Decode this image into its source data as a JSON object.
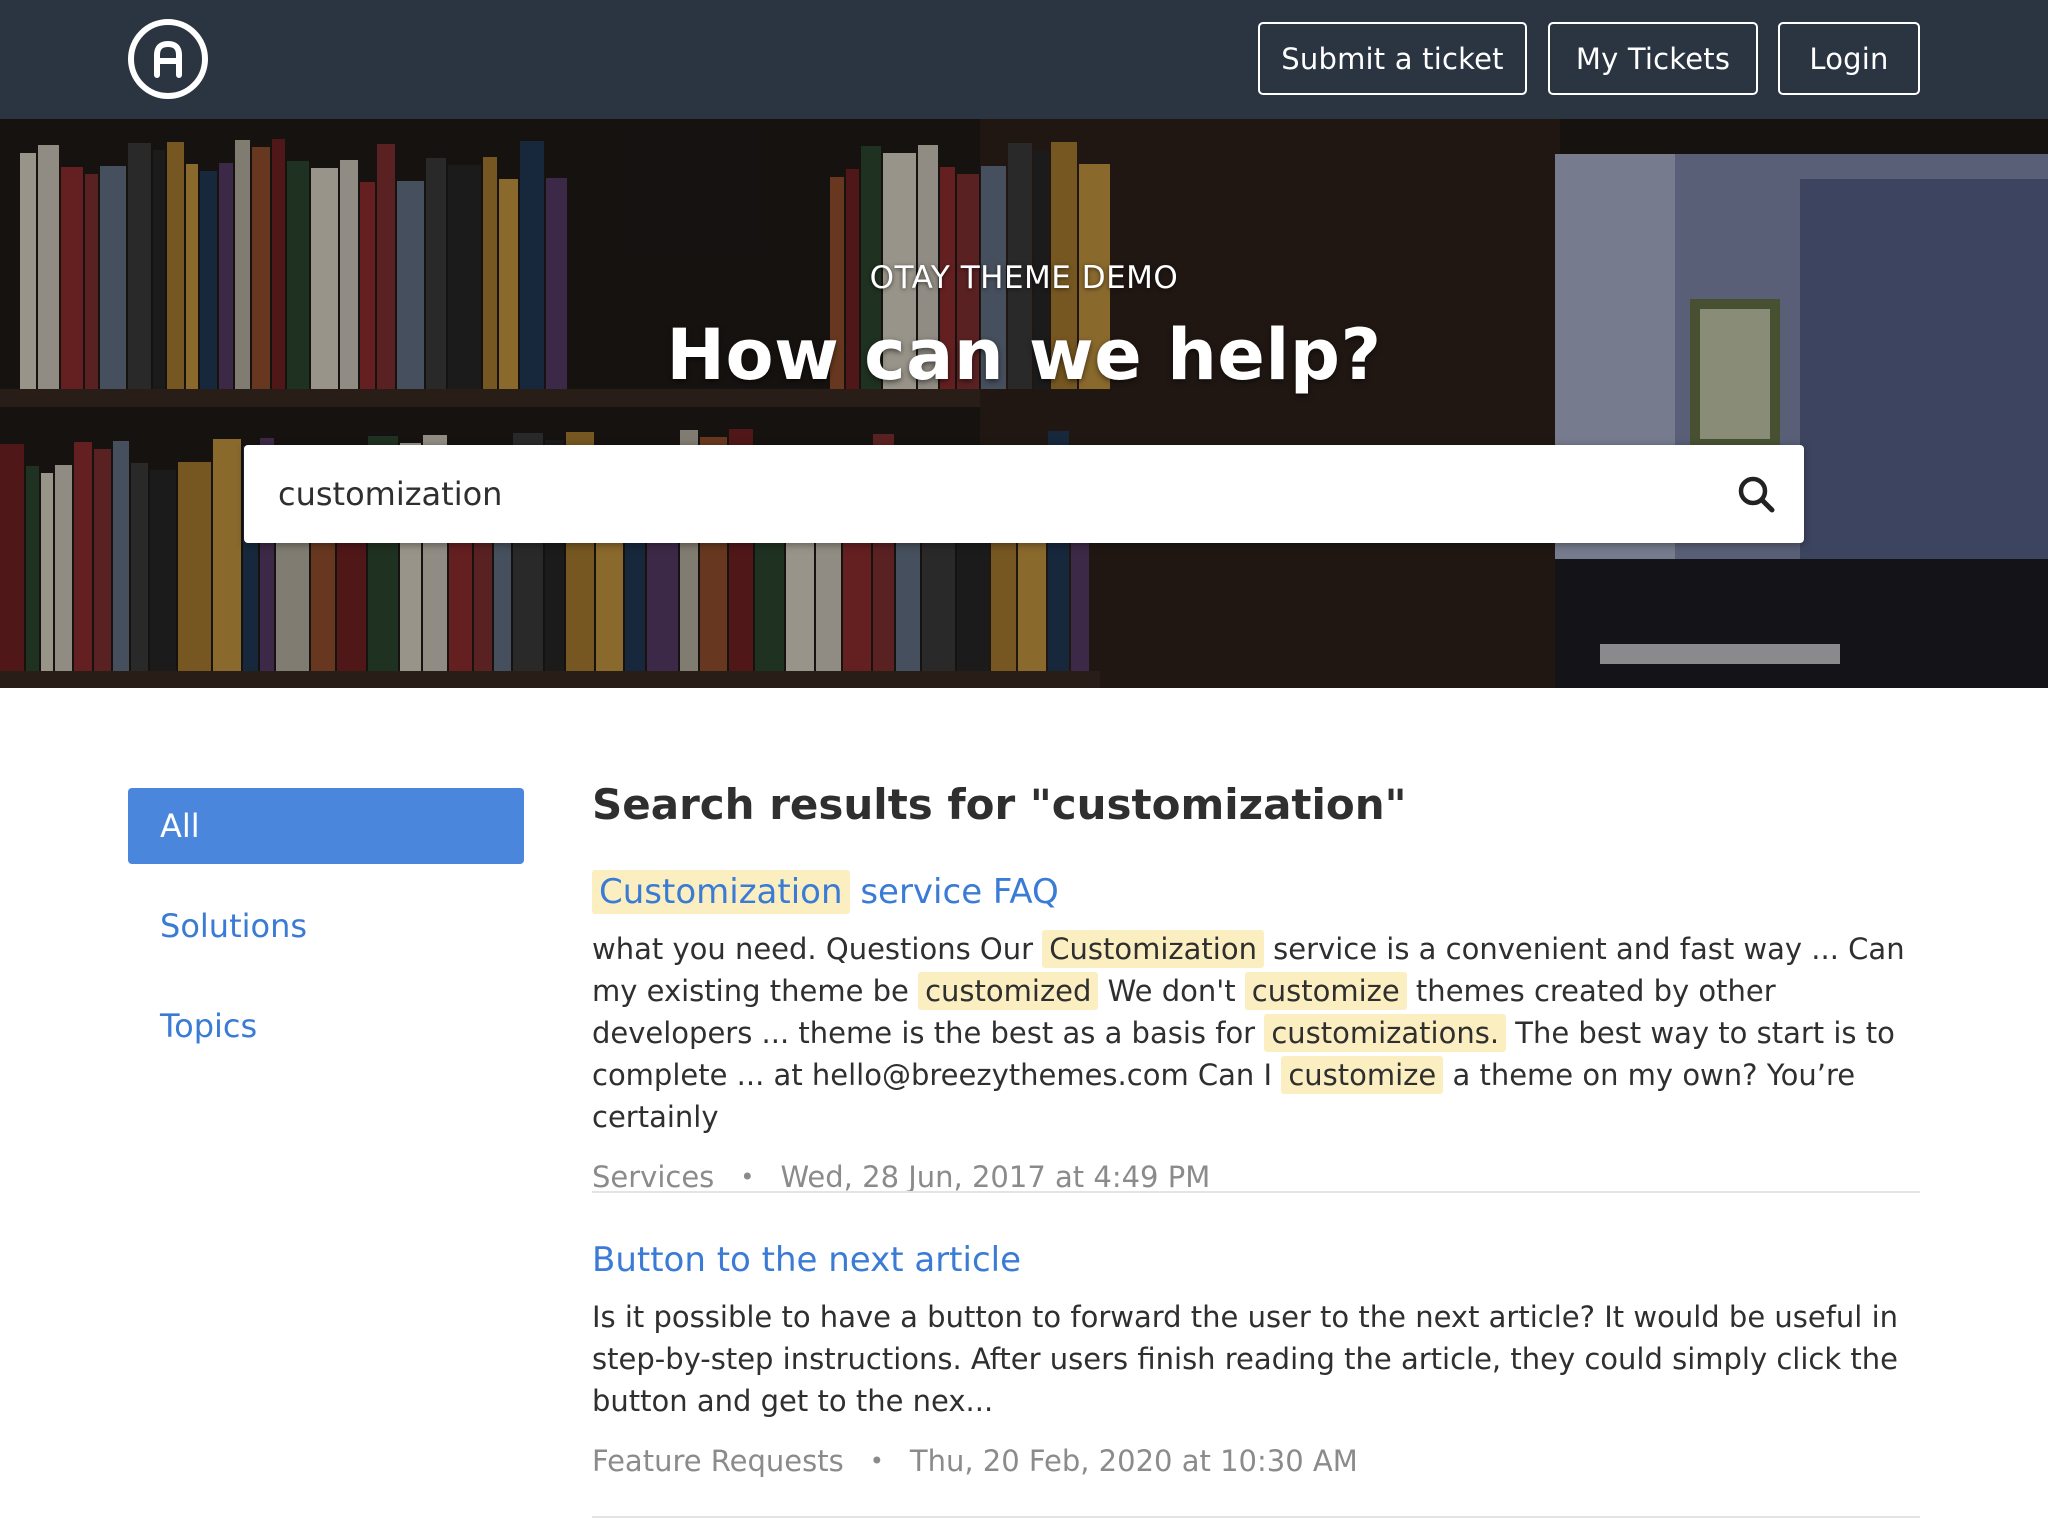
{
  "nav": {
    "logo_letter": "A",
    "submit_label": "Submit a ticket",
    "tickets_label": "My Tickets",
    "login_label": "Login"
  },
  "hero": {
    "kicker": "OTAY THEME DEMO",
    "title": "How can we help?"
  },
  "search": {
    "value": "customization",
    "icon": "search-icon"
  },
  "filters": {
    "all": "All",
    "solutions": "Solutions",
    "topics": "Topics"
  },
  "results": {
    "heading": "Search results for \"customization\"",
    "items": [
      {
        "title_highlight": "Customization",
        "title_rest": " service FAQ",
        "snippet": [
          {
            "t": "what you need.  Questions Our ",
            "h": false
          },
          {
            "t": "Customization",
            "h": true
          },
          {
            "t": " service is a convenient and fast way ... Can my existing theme be ",
            "h": false
          },
          {
            "t": "customized",
            "h": true
          },
          {
            "t": " We don't ",
            "h": false
          },
          {
            "t": "customize",
            "h": true
          },
          {
            "t": " themes created by other developers ... theme is the best as a basis for ",
            "h": false
          },
          {
            "t": "customizations.",
            "h": true
          },
          {
            "t": " The best way to start is to complete ... at hello@breezythemes.com Can I ",
            "h": false
          },
          {
            "t": "customize",
            "h": true
          },
          {
            "t": " a theme on my own? You’re certainly",
            "h": false
          }
        ],
        "category": "Services",
        "date": "Wed, 28 Jun, 2017 at 4:49 PM"
      },
      {
        "title": "Button to the next article",
        "snippet": "Is it possible to have a button to forward the user to the next article? It would be useful in step-by-step instructions. After users finish reading the article, they could simply click the button and get to the nex...",
        "category": "Feature Requests",
        "date": "Thu, 20 Feb, 2020 at 10:30 AM"
      }
    ]
  },
  "colors": {
    "topbar": "#2b3441",
    "link": "#3a7bd5",
    "active_filter": "#4a86dc",
    "highlight": "#fbefc1",
    "meta": "#8b8b8b"
  }
}
